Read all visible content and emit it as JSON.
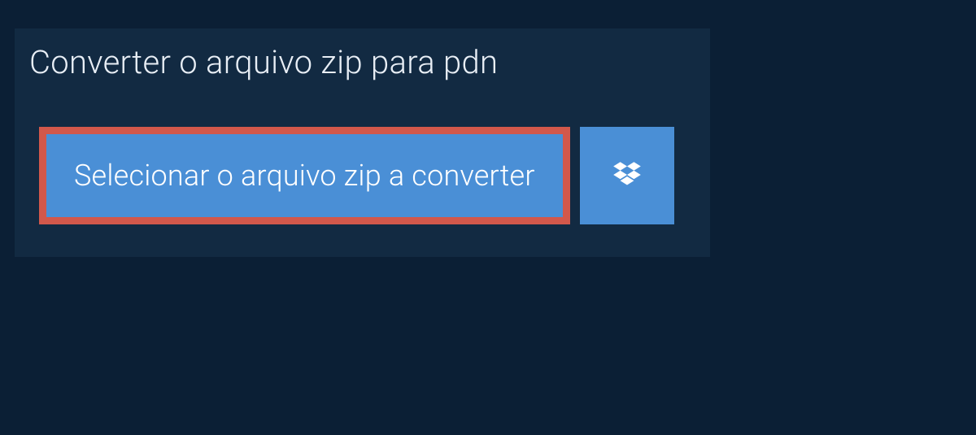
{
  "header": {
    "title": "Converter o arquivo zip para pdn"
  },
  "actions": {
    "select_file_label": "Selecionar o arquivo zip a converter",
    "dropbox_label": "Dropbox"
  }
}
